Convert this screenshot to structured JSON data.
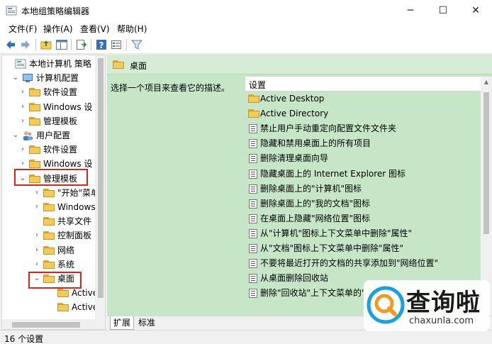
{
  "window": {
    "title": "本地组策略编辑器",
    "controls": {
      "minimize": "─",
      "maximize": "☐",
      "close": "✕"
    }
  },
  "menu": [
    "文件(F)",
    "操作(A)",
    "查看(V)",
    "帮助(H)"
  ],
  "toolbar": {
    "icons": [
      "back-arrow-icon",
      "forward-arrow-icon",
      "up-folder-icon",
      "show-hide-tree-icon",
      "export-list-icon",
      "help-icon",
      "properties-icon",
      "filter-icon"
    ]
  },
  "tree": {
    "items": [
      {
        "label": "本地计算机 策略",
        "expander": "",
        "icon": "policy-icon"
      },
      {
        "label": "计算机配置",
        "expander": "⌄",
        "icon": "computer-icon"
      },
      {
        "label": "软件设置",
        "expander": "›",
        "icon": "folder-icon"
      },
      {
        "label": "Windows 设",
        "expander": "›",
        "icon": "folder-icon"
      },
      {
        "label": "管理模板",
        "expander": "›",
        "icon": "folder-icon"
      },
      {
        "label": "用户配置",
        "expander": "⌄",
        "icon": "user-icon"
      },
      {
        "label": "软件设置",
        "expander": "›",
        "icon": "folder-icon"
      },
      {
        "label": "Windows 设",
        "expander": "›",
        "icon": "folder-icon"
      },
      {
        "label": "管理模板",
        "expander": "⌄",
        "icon": "folder-icon"
      },
      {
        "label": "\"开始\"菜单",
        "expander": "›",
        "icon": "folder-icon"
      },
      {
        "label": "Windows",
        "expander": "›",
        "icon": "folder-icon"
      },
      {
        "label": "共享文件",
        "expander": "",
        "icon": "folder-icon"
      },
      {
        "label": "控制面板",
        "expander": "›",
        "icon": "folder-icon"
      },
      {
        "label": "网络",
        "expander": "›",
        "icon": "folder-icon"
      },
      {
        "label": "系统",
        "expander": "›",
        "icon": "folder-icon"
      },
      {
        "label": "桌面",
        "expander": "⌄",
        "icon": "folder-open-icon"
      },
      {
        "label": "Active",
        "expander": "",
        "icon": "folder-icon"
      },
      {
        "label": "Active",
        "expander": "",
        "icon": "folder-icon"
      }
    ]
  },
  "pane": {
    "header": "桌面",
    "description": "选择一个项目来查看它的描述。",
    "column_header": "设置",
    "items": [
      {
        "label": "Active Desktop",
        "type": "folder"
      },
      {
        "label": "Active Directory",
        "type": "folder"
      },
      {
        "label": "禁止用户手动重定向配置文件文件夹",
        "type": "setting"
      },
      {
        "label": "隐藏和禁用桌面上的所有项目",
        "type": "setting"
      },
      {
        "label": "删除清理桌面向导",
        "type": "setting"
      },
      {
        "label": "隐藏桌面上的 Internet Explorer 图标",
        "type": "setting"
      },
      {
        "label": "删除桌面上的\"计算机\"图标",
        "type": "setting"
      },
      {
        "label": "删除桌面上的\"我的文档\"图标",
        "type": "setting"
      },
      {
        "label": "在桌面上隐藏\"网络位置\"图标",
        "type": "setting"
      },
      {
        "label": "从\"计算机\"图标上下文菜单中删除\"属性\"",
        "type": "setting"
      },
      {
        "label": "从\"文档\"图标上下文菜单中删除\"属性\"",
        "type": "setting"
      },
      {
        "label": "不要将最近打开的文档的共享添加到\"网络位置\"",
        "type": "setting"
      },
      {
        "label": "从桌面删除回收站",
        "type": "setting"
      },
      {
        "label": "删除\"回收站\"上下文菜单的\"",
        "type": "setting"
      }
    ]
  },
  "tabs": [
    "扩展",
    "标准"
  ],
  "status": "16 个设置",
  "watermark": {
    "title": "查询啦",
    "url": "chaxunla.com"
  },
  "colors": {
    "highlight": "#e0201b",
    "pane_background": "#c7e6c7",
    "folder": "#f3cb5c",
    "watermark_blue": "#1a9fe0",
    "watermark_orange": "#f29a1f"
  }
}
